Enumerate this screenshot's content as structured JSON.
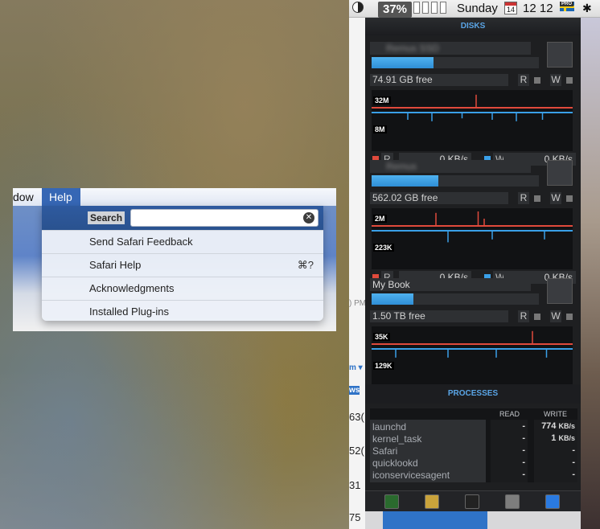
{
  "menubar": {
    "battery_pct": "37%",
    "day": "Sunday",
    "date_badge": "14",
    "time": "12 12",
    "flag_badge": "PRO",
    "bluetooth_glyph": "✱"
  },
  "safari": {
    "window_menu": "dow",
    "help_menu": "Help",
    "search_label": "Search",
    "search_value": "",
    "items": [
      {
        "label": "Send Safari Feedback",
        "shortcut": ""
      },
      {
        "label": "Safari Help",
        "shortcut": "⌘?"
      },
      {
        "label": "Acknowledgments",
        "shortcut": ""
      },
      {
        "label": "Installed Plug-ins",
        "shortcut": ""
      }
    ]
  },
  "page_strip": [
    ") PM",
    "m ▾",
    "ws",
    "63(",
    "52(",
    "31",
    "75"
  ],
  "panel": {
    "disks_title": "DISKS",
    "processes_title": "PROCESSES",
    "disks": [
      {
        "name": "Remus SSD",
        "name_blurred": true,
        "free": "74.91 GB free",
        "usage": 0.37,
        "top_label": "32M",
        "bottom_label": "8M",
        "read_label": "R",
        "write_label": "W",
        "read_rate": "0 KB/s",
        "write_rate": "0 KB/s",
        "icon": "flash-drive-icon"
      },
      {
        "name": "Remus",
        "name_blurred": true,
        "free": "562.02 GB free",
        "usage": 0.4,
        "top_label": "2M",
        "bottom_label": "223K",
        "read_label": "R",
        "write_label": "W",
        "read_rate": "0 KB/s",
        "write_rate": "0 KB/s",
        "icon": "imac-icon"
      },
      {
        "name": "My Book",
        "name_blurred": false,
        "free": "1.50 TB free",
        "usage": 0.25,
        "top_label": "35K",
        "bottom_label": "129K",
        "read_label": "R",
        "write_label": "W",
        "read_rate": "0 KB/s",
        "write_rate": "0 KB/s",
        "icon": "external-drive-icon"
      }
    ],
    "proc_read_header": "READ",
    "proc_write_header": "WRITE",
    "processes": [
      {
        "name": "launchd",
        "read": "-",
        "write": "774",
        "write_unit": "KB/s"
      },
      {
        "name": "kernel_task",
        "read": "-",
        "write": "1",
        "write_unit": "KB/s"
      },
      {
        "name": "Safari",
        "read": "-",
        "write": "-",
        "write_unit": ""
      },
      {
        "name": "quicklookd",
        "read": "-",
        "write": "-",
        "write_unit": ""
      },
      {
        "name": "iconservicesagent",
        "read": "-",
        "write": "-",
        "write_unit": ""
      }
    ],
    "dock_icons": [
      "activity-monitor-icon",
      "istat-icon",
      "terminal-icon",
      "preview-icon",
      "safari-icon"
    ]
  },
  "colors": {
    "accent": "#5aa5e6",
    "read": "#e04a3c",
    "write": "#3aa0e8",
    "usage": "#3aa0e8"
  }
}
